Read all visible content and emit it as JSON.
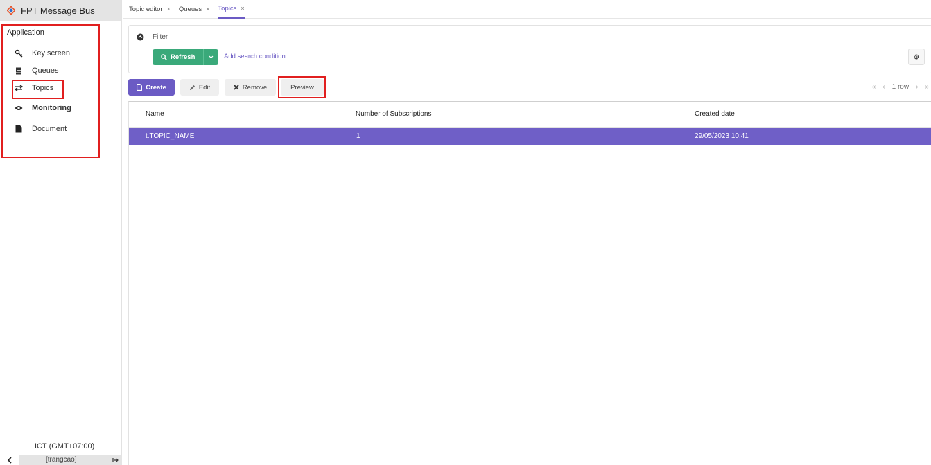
{
  "app": {
    "title": "FPT Message Bus"
  },
  "sidebar": {
    "heading": "Application",
    "items": [
      {
        "label": "Key screen",
        "icon": "key-icon"
      },
      {
        "label": "Queues",
        "icon": "list-icon"
      },
      {
        "label": "Topics",
        "icon": "exchange-icon"
      },
      {
        "label": "Monitoring",
        "icon": "eye-icon"
      },
      {
        "label": "Document",
        "icon": "file-icon"
      }
    ],
    "timezone": "ICT (GMT+07:00)",
    "user": "[trangcao]"
  },
  "tabs": [
    {
      "label": "Topic editor",
      "close": "×"
    },
    {
      "label": "Queues",
      "close": "×"
    },
    {
      "label": "Topics",
      "close": "×",
      "active": true
    }
  ],
  "filter": {
    "label": "Filter",
    "refresh_label": "Refresh",
    "add_condition": "Add search condition"
  },
  "toolbar": {
    "create": "Create",
    "edit": "Edit",
    "remove": "Remove",
    "preview": "Preview"
  },
  "pager": {
    "first": "«",
    "prev": "‹",
    "text": "1 row",
    "next": "›",
    "last": "»"
  },
  "table": {
    "columns": [
      "Name",
      "Number of Subscriptions",
      "Created date"
    ],
    "rows": [
      {
        "name": "t.TOPIC_NAME",
        "subscriptions": "1",
        "created": "29/05/2023 10:41"
      }
    ]
  },
  "colors": {
    "accent": "#6b5bc4",
    "success": "#3aa97a",
    "highlight_border": "#e11f1f"
  }
}
